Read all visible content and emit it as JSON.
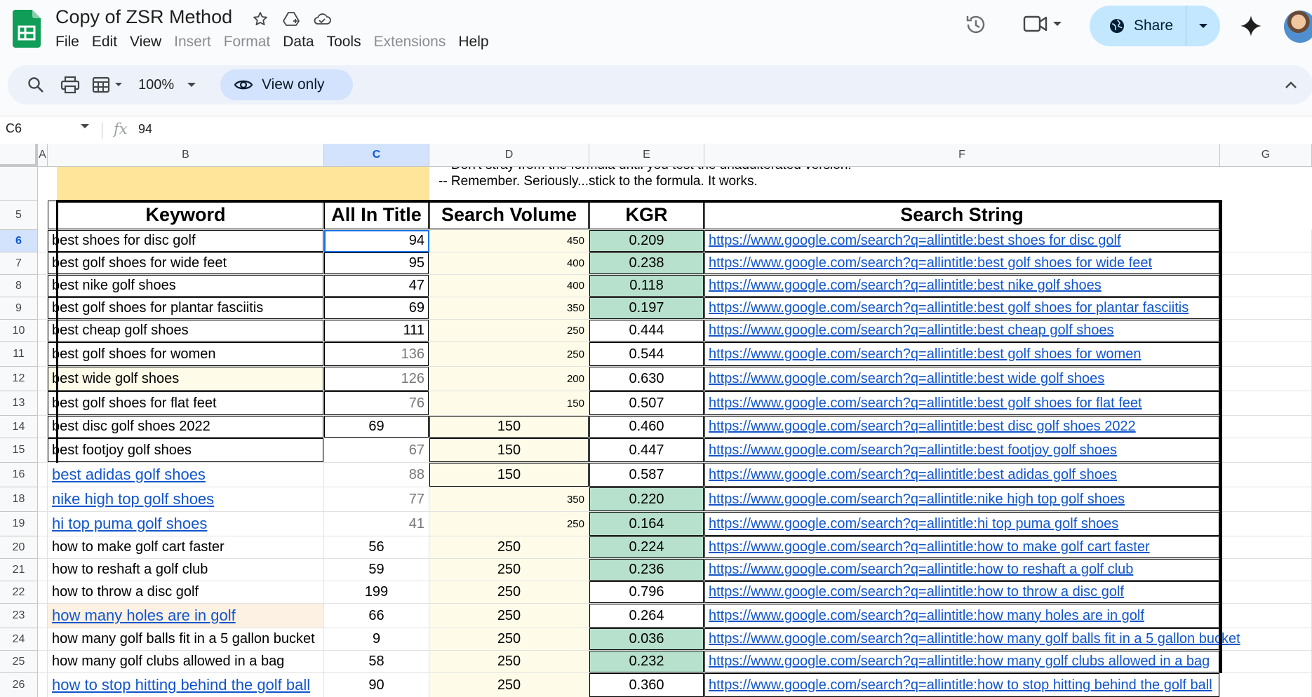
{
  "app": {
    "title": "Copy of ZSR Method",
    "menu": [
      {
        "label": "File",
        "disabled": false
      },
      {
        "label": "Edit",
        "disabled": false
      },
      {
        "label": "View",
        "disabled": false
      },
      {
        "label": "Insert",
        "disabled": true
      },
      {
        "label": "Format",
        "disabled": true
      },
      {
        "label": "Data",
        "disabled": false
      },
      {
        "label": "Tools",
        "disabled": false
      },
      {
        "label": "Extensions",
        "disabled": true
      },
      {
        "label": "Help",
        "disabled": false
      }
    ],
    "share_label": "Share",
    "accent": "#c2e7ff"
  },
  "toolbar": {
    "zoom": "100%",
    "view_only_label": "View only"
  },
  "formula_bar": {
    "cell_ref": "C6",
    "fx": "fx",
    "value": "94"
  },
  "sheet": {
    "columns": [
      "A",
      "B",
      "C",
      "D",
      "E",
      "F",
      "G"
    ],
    "selected_column": "C",
    "note_line1": "-- Don't stray from the formula until you test the unadulterated version.",
    "note_line2": "-- Remember. Seriously...stick to the formula. It works.",
    "headers": {
      "keyword": "Keyword",
      "all_in_title": "All In Title",
      "search_volume": "Search Volume",
      "kgr": "KGR",
      "search_string": "Search String"
    },
    "header_row_number": "5",
    "rows": [
      {
        "n": "6",
        "keyword": "best shoes for disc golf",
        "ait": "94",
        "sv": "450",
        "kgr": "0.209",
        "url": "https://www.google.com/search?q=allintitle:best shoes for disc golf"
      },
      {
        "n": "7",
        "keyword": "best golf shoes for wide feet",
        "ait": "95",
        "sv": "400",
        "kgr": "0.238",
        "url": "https://www.google.com/search?q=allintitle:best golf shoes for wide feet"
      },
      {
        "n": "8",
        "keyword": "best nike golf shoes",
        "ait": "47",
        "sv": "400",
        "kgr": "0.118",
        "url": "https://www.google.com/search?q=allintitle:best nike golf shoes"
      },
      {
        "n": "9",
        "keyword": "best golf shoes for plantar fasciitis",
        "ait": "69",
        "sv": "350",
        "kgr": "0.197",
        "url": "https://www.google.com/search?q=allintitle:best golf shoes for plantar fasciitis"
      },
      {
        "n": "10",
        "keyword": "best cheap golf shoes",
        "ait": "111",
        "sv": "250",
        "kgr": "0.444",
        "url": "https://www.google.com/search?q=allintitle:best cheap golf shoes"
      },
      {
        "n": "11",
        "keyword": "best golf shoes for women",
        "ait": "136",
        "sv": "250",
        "kgr": "0.544",
        "url": "https://www.google.com/search?q=allintitle:best golf shoes for women"
      },
      {
        "n": "12",
        "keyword": "best wide golf shoes",
        "ait": "126",
        "sv": "200",
        "kgr": "0.630",
        "url": "https://www.google.com/search?q=allintitle:best wide golf shoes"
      },
      {
        "n": "13",
        "keyword": "best golf shoes for flat feet",
        "ait": "76",
        "sv": "150",
        "kgr": "0.507",
        "url": "https://www.google.com/search?q=allintitle:best golf shoes for flat feet"
      },
      {
        "n": "14",
        "keyword": "best disc golf shoes 2022",
        "ait": "69",
        "sv": "150",
        "kgr": "0.460",
        "url": "https://www.google.com/search?q=allintitle:best disc golf shoes 2022"
      },
      {
        "n": "15",
        "keyword": "best footjoy golf shoes",
        "ait": "67",
        "sv": "150",
        "kgr": "0.447",
        "url": "https://www.google.com/search?q=allintitle:best footjoy golf shoes"
      },
      {
        "n": "16",
        "keyword": "best adidas golf shoes",
        "ait": "88",
        "sv": "150",
        "kgr": "0.587",
        "url": "https://www.google.com/search?q=allintitle:best adidas golf shoes"
      },
      {
        "n": "18",
        "keyword": "nike high top golf shoes",
        "ait": "77",
        "sv": "350",
        "kgr": "0.220",
        "url": "https://www.google.com/search?q=allintitle:nike high top golf shoes"
      },
      {
        "n": "19",
        "keyword": "hi top puma golf shoes",
        "ait": "41",
        "sv": "250",
        "kgr": "0.164",
        "url": "https://www.google.com/search?q=allintitle:hi top puma golf shoes"
      },
      {
        "n": "20",
        "keyword": "how to make golf cart faster",
        "ait": "56",
        "sv": "250",
        "kgr": "0.224",
        "url": "https://www.google.com/search?q=allintitle:how to make golf cart faster"
      },
      {
        "n": "21",
        "keyword": "how to reshaft a golf club",
        "ait": "59",
        "sv": "250",
        "kgr": "0.236",
        "url": "https://www.google.com/search?q=allintitle:how to reshaft a golf club"
      },
      {
        "n": "22",
        "keyword": "how to throw a disc golf",
        "ait": "199",
        "sv": "250",
        "kgr": "0.796",
        "url": "https://www.google.com/search?q=allintitle:how to throw a disc golf"
      },
      {
        "n": "23",
        "keyword": "how many holes are in golf",
        "ait": "66",
        "sv": "250",
        "kgr": "0.264",
        "url": "https://www.google.com/search?q=allintitle:how many holes are in golf"
      },
      {
        "n": "24",
        "keyword": "how many golf balls fit in a 5 gallon bucket",
        "ait": "9",
        "sv": "250",
        "kgr": "0.036",
        "url": "https://www.google.com/search?q=allintitle:how many golf balls fit in a 5 gallon bucket"
      },
      {
        "n": "25",
        "keyword": "how many golf clubs allowed in a bag",
        "ait": "58",
        "sv": "250",
        "kgr": "0.232",
        "url": "https://www.google.com/search?q=allintitle:how many golf clubs allowed in a bag"
      },
      {
        "n": "26",
        "keyword": "how to stop hitting behind the golf ball",
        "ait": "90",
        "sv": "250",
        "kgr": "0.360",
        "url": "https://www.google.com/search?q=allintitle:how to stop hitting behind the golf ball"
      }
    ],
    "colors": {
      "kgr_good": "#b7e1cd",
      "volume_fill": "#fefce8",
      "header_fill": "#fee599",
      "link": "#1155cc"
    }
  }
}
